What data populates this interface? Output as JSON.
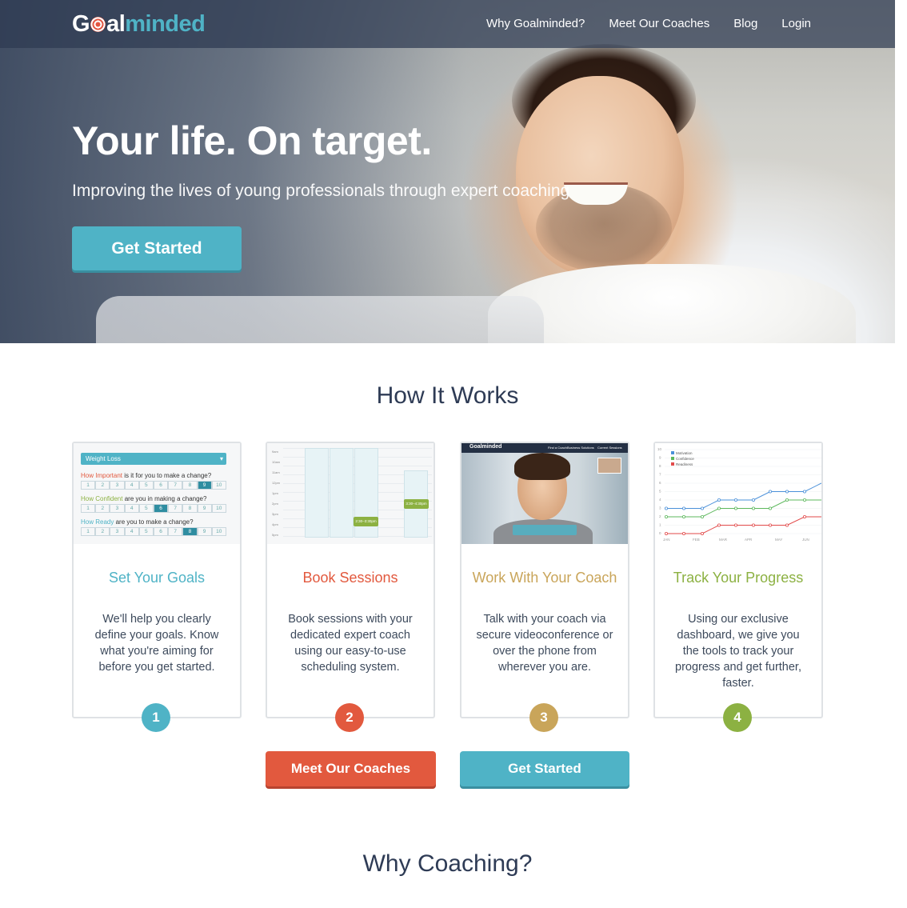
{
  "nav": {
    "logo_part1": "G",
    "logo_part2": "al",
    "logo_part3": "minded",
    "links": [
      "Why Goalminded?",
      "Meet Our Coaches",
      "Blog",
      "Login"
    ]
  },
  "hero": {
    "title": "Your life. On target.",
    "subtitle": "Improving the lives of young professionals through expert coaching",
    "cta": "Get Started"
  },
  "how": {
    "title": "How It Works",
    "steps": [
      {
        "number": "1",
        "title": "Set Your Goals",
        "text": "We'll help you clearly define your goals. Know what you're aiming for before you get started.",
        "color": "#4fb3c6"
      },
      {
        "number": "2",
        "title": "Book Sessions",
        "text": "Book sessions with your dedicated expert coach using our easy-to-use scheduling system.",
        "color": "#e2593e"
      },
      {
        "number": "3",
        "title": "Work With Your Coach",
        "text": "Talk with your coach via secure videoconference or over the phone from wherever you are.",
        "color": "#c9a55a"
      },
      {
        "number": "4",
        "title": "Track Your Progress",
        "text": "Using our exclusive dashboard, we give you the tools to track your progress and get further, faster.",
        "color": "#8cb142"
      }
    ],
    "buttons": {
      "coaches": "Meet Our Coaches",
      "started": "Get Started"
    }
  },
  "thumb_goals": {
    "dropdown": "Weight Loss",
    "questions": [
      {
        "highlight": "How Important",
        "rest": " is it for you to make a change?",
        "color": "#e2593e",
        "selected": 9
      },
      {
        "highlight": "How Confident",
        "rest": " are you in making a change?",
        "color": "#8cb142",
        "selected": 6
      },
      {
        "highlight": "How Ready",
        "rest": " are you to make a change?",
        "color": "#4fb3c6",
        "selected": 8
      }
    ],
    "scale": [
      "1",
      "2",
      "3",
      "4",
      "5",
      "6",
      "7",
      "8",
      "9",
      "10"
    ]
  },
  "thumb_calendar": {
    "times": [
      "9am",
      "10am",
      "11am",
      "12pm",
      "1pm",
      "2pm",
      "3pm",
      "4pm",
      "5pm"
    ],
    "event1": "2:30–3:30pm",
    "event2": "3:30–4:30pm"
  },
  "thumb_video": {
    "brand": "Goalminded",
    "menu": [
      "Find a Coach",
      "Business Solutions",
      "Current Sessions"
    ]
  },
  "thumb_chart": {
    "legend": [
      {
        "name": "Motivation",
        "color": "#4a90d9"
      },
      {
        "name": "Confidence",
        "color": "#5cb85c"
      },
      {
        "name": "Readiness",
        "color": "#e24a4a"
      }
    ],
    "months": [
      "JAN",
      "FEB",
      "MAR",
      "APR",
      "MAY",
      "JUN"
    ],
    "y_ticks": [
      "10",
      "9",
      "8",
      "7",
      "6",
      "5",
      "4",
      "3",
      "2",
      "1",
      "0"
    ]
  },
  "why": {
    "title": "Why Coaching?"
  }
}
